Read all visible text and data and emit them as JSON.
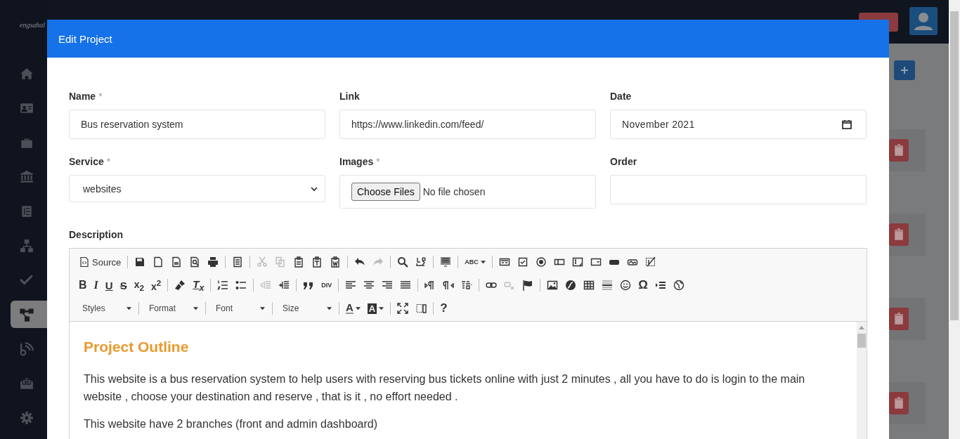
{
  "background": {
    "logo": "engsahal",
    "nav_items": [
      {
        "kind": "home",
        "selected": false
      },
      {
        "kind": "id-card",
        "selected": false
      },
      {
        "kind": "briefcase",
        "selected": false
      },
      {
        "kind": "bank",
        "selected": false
      },
      {
        "kind": "list",
        "selected": false
      },
      {
        "kind": "network",
        "selected": false
      },
      {
        "kind": "check",
        "selected": false
      },
      {
        "kind": "nodes",
        "selected": true
      },
      {
        "kind": "rss",
        "selected": false
      },
      {
        "kind": "mail",
        "selected": false
      },
      {
        "kind": "gear",
        "selected": false
      }
    ]
  },
  "modal": {
    "title": "Edit Project",
    "fields": [
      {
        "kind": "text",
        "label": "Name",
        "required_mark": "*",
        "value": "Bus reservation system"
      },
      {
        "kind": "text",
        "label": "Link",
        "value": "https://www.linkedin.com/feed/"
      },
      {
        "kind": "date",
        "label": "Date",
        "value": "November 2021"
      },
      {
        "kind": "select",
        "label": "Service",
        "required_mark": "*",
        "value": "websites"
      },
      {
        "kind": "file",
        "label": "Images",
        "required_mark": "*",
        "button": "Choose Files",
        "status": "No file chosen"
      },
      {
        "kind": "text",
        "label": "Order"
      }
    ],
    "description": {
      "label": "Description",
      "toolbar": [
        [
          {
            "kind": "source",
            "label": "Source",
            "disabled": false
          },
          {
            "kind": "sep"
          },
          {
            "kind": "save",
            "disabled": false
          },
          {
            "kind": "newpage",
            "disabled": false
          },
          {
            "kind": "pdf",
            "disabled": false
          },
          {
            "kind": "preview",
            "disabled": false
          },
          {
            "kind": "print",
            "disabled": false
          },
          {
            "kind": "sep"
          },
          {
            "kind": "templates",
            "disabled": false
          },
          {
            "kind": "sep"
          },
          {
            "kind": "cut",
            "disabled": true
          },
          {
            "kind": "copy",
            "disabled": true
          },
          {
            "kind": "paste",
            "disabled": false
          },
          {
            "kind": "pastetext",
            "disabled": false
          },
          {
            "kind": "pasteword",
            "disabled": false
          },
          {
            "kind": "sep"
          },
          {
            "kind": "undo",
            "disabled": false
          },
          {
            "kind": "redo",
            "disabled": true
          },
          {
            "kind": "sep"
          },
          {
            "kind": "find",
            "disabled": false
          },
          {
            "kind": "replace",
            "disabled": false
          },
          {
            "kind": "sep"
          },
          {
            "kind": "selectall",
            "disabled": false
          },
          {
            "kind": "sep"
          },
          {
            "kind": "spellcheck",
            "label": "ABC",
            "disabled": false
          },
          {
            "kind": "sep"
          },
          {
            "kind": "form",
            "disabled": false
          },
          {
            "kind": "checkbox",
            "disabled": false
          },
          {
            "kind": "radio",
            "disabled": false
          },
          {
            "kind": "textfield",
            "disabled": false
          },
          {
            "kind": "textarea",
            "disabled": false
          },
          {
            "kind": "selectfield",
            "disabled": false
          },
          {
            "kind": "formbutton",
            "disabled": false
          },
          {
            "kind": "imagebutton",
            "disabled": false
          },
          {
            "kind": "hiddenfield",
            "disabled": false
          }
        ],
        [
          {
            "kind": "bold",
            "label": "B",
            "disabled": false
          },
          {
            "kind": "italic",
            "label": "I",
            "disabled": false
          },
          {
            "kind": "underline",
            "label": "U",
            "disabled": false
          },
          {
            "kind": "strike",
            "label": "S",
            "disabled": false
          },
          {
            "kind": "subscript",
            "label": "x$_{2}$",
            "disabled": false
          },
          {
            "kind": "superscript",
            "label": "x$^{2}$",
            "disabled": false
          },
          {
            "kind": "sep"
          },
          {
            "kind": "brush",
            "disabled": false
          },
          {
            "kind": "removeformat",
            "label": "T$_{x}$",
            "disabled": false
          },
          {
            "kind": "sep"
          },
          {
            "kind": "numbered",
            "disabled": false
          },
          {
            "kind": "bulleted",
            "disabled": false
          },
          {
            "kind": "sep"
          },
          {
            "kind": "outdent",
            "disabled": true
          },
          {
            "kind": "indent",
            "disabled": false
          },
          {
            "kind": "sep"
          },
          {
            "kind": "quote",
            "disabled": false
          },
          {
            "kind": "div",
            "label": "DIV",
            "disabled": false
          },
          {
            "kind": "sep"
          },
          {
            "kind": "alignleft",
            "disabled": false
          },
          {
            "kind": "aligncenter",
            "disabled": false
          },
          {
            "kind": "alignright",
            "disabled": false
          },
          {
            "kind": "justify",
            "disabled": false
          },
          {
            "kind": "sep"
          },
          {
            "kind": "ltr",
            "disabled": false
          },
          {
            "kind": "rtl",
            "disabled": false
          },
          {
            "kind": "language",
            "disabled": false
          },
          {
            "kind": "sep"
          },
          {
            "kind": "link",
            "disabled": false
          },
          {
            "kind": "unlink",
            "disabled": true
          },
          {
            "kind": "anchor",
            "disabled": false
          },
          {
            "kind": "sep"
          },
          {
            "kind": "image",
            "disabled": false
          },
          {
            "kind": "flash",
            "disabled": false
          },
          {
            "kind": "table",
            "disabled": false
          },
          {
            "kind": "hr",
            "disabled": false
          },
          {
            "kind": "smiley",
            "disabled": false
          },
          {
            "kind": "specialchar",
            "label": "Ω",
            "disabled": false
          },
          {
            "kind": "pagebreak",
            "disabled": false
          },
          {
            "kind": "iframe",
            "disabled": false
          }
        ],
        [
          {
            "kind": "combo",
            "label": "Styles"
          },
          {
            "kind": "sep"
          },
          {
            "kind": "combo",
            "label": "Format"
          },
          {
            "kind": "sep"
          },
          {
            "kind": "combo",
            "label": "Font"
          },
          {
            "kind": "sep"
          },
          {
            "kind": "combo",
            "label": "Size"
          },
          {
            "kind": "sep"
          },
          {
            "kind": "textcolor",
            "label": "A",
            "disabled": false
          },
          {
            "kind": "bgcolor",
            "label": "A",
            "disabled": false
          },
          {
            "kind": "sep"
          },
          {
            "kind": "maximize",
            "disabled": false
          },
          {
            "kind": "showblocks",
            "disabled": false
          },
          {
            "kind": "sep"
          },
          {
            "kind": "about",
            "label": "?",
            "disabled": false
          }
        ]
      ],
      "content": [
        {
          "kind": "heading",
          "text": "Project Outline"
        },
        {
          "kind": "paragraph",
          "text": "This website is a bus reservation system to help users with reserving bus tickets online with just 2 minutes , all you have to do is login to the main website , choose your destination and reserve , that is it , no effort needed ."
        },
        {
          "kind": "paragraph",
          "text": "This website have 2 branches (front and admin dashboard)"
        }
      ]
    }
  }
}
